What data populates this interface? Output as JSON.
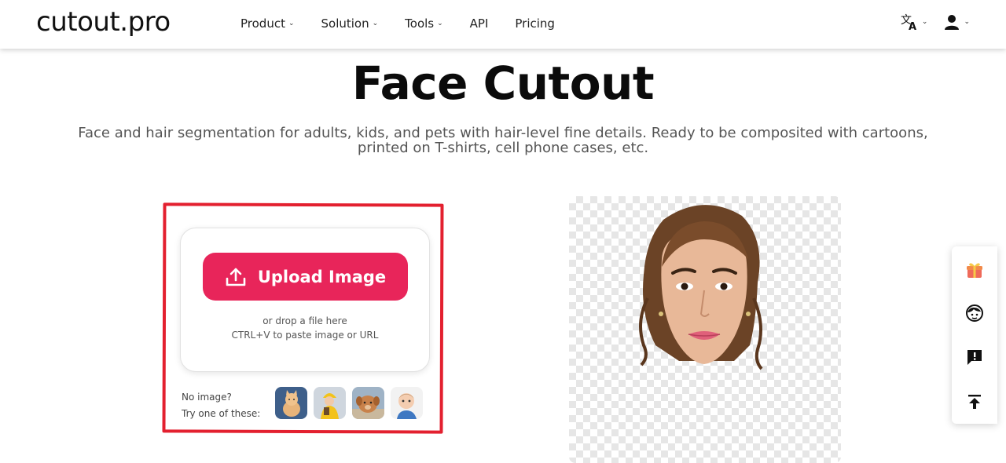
{
  "header": {
    "logo": "cutout.pro",
    "nav": [
      {
        "label": "Product",
        "dropdown": true
      },
      {
        "label": "Solution",
        "dropdown": true
      },
      {
        "label": "Tools",
        "dropdown": true
      },
      {
        "label": "API",
        "dropdown": false
      },
      {
        "label": "Pricing",
        "dropdown": false
      }
    ],
    "right_icons": [
      "translate-icon",
      "user-icon"
    ]
  },
  "hero": {
    "title": "Face Cutout",
    "subtitle_line1": "Face and hair segmentation for adults, kids, and pets with hair-level fine details. Ready to be composited with cartoons,",
    "subtitle_line2": "printed on T-shirts, cell phone cases, etc."
  },
  "upload": {
    "button_label": "Upload Image",
    "drop_hint": "or drop a file here",
    "paste_hint": "CTRL+V to paste image or URL",
    "no_image_line1": "No image?",
    "no_image_line2": "Try one of these:",
    "samples": [
      "cat-sample",
      "child-in-yellow-sample",
      "dog-sample",
      "baby-sample"
    ]
  },
  "colors": {
    "accent": "#e8255a",
    "annotation_red": "#e3202f"
  },
  "side_toolbar": [
    "gift-icon",
    "support-face-icon",
    "feedback-icon",
    "back-to-top-icon"
  ]
}
